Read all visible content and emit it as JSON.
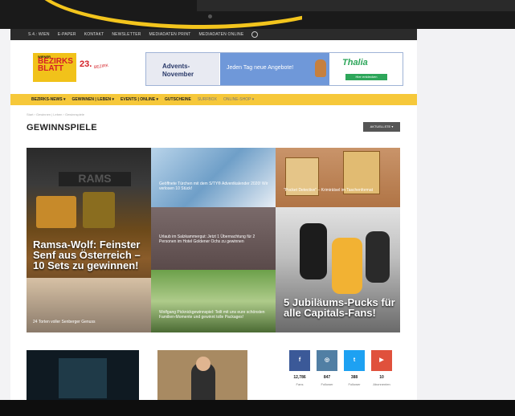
{
  "topnav": {
    "items": [
      "S.4.: WIEN",
      "E-PAPER",
      "KONTAKT",
      "NEWSLETTER",
      "MEDIADATEN PRINT",
      "MEDIADATEN ONLINE"
    ]
  },
  "logo": {
    "small": "WIENER",
    "name1": "BEZIRKS",
    "name2": "BLATT",
    "num": "23.",
    "tag": "BEZIRK"
  },
  "banner": {
    "advent1": "Advents-",
    "advent2": "November",
    "offer": "Jeden Tag neue Angebote!",
    "brand": "Thalia",
    "cta": "Hier entdecken"
  },
  "menu": {
    "items": [
      "BEZIRKS-NEWS ▾",
      "GEWINNEN | LEBEN ▾",
      "EVENTS | ONLINE ▾",
      "GUTSCHEINE",
      "SURFBOX",
      "ONLINE-SHOP ▾"
    ]
  },
  "breadcrumb": "Start › Gewinnen | Leben › Gewinnspiele",
  "page_title": "GEWINNSPIELE",
  "sort_label": "AKTUELLSTE ▾",
  "tiles": {
    "main_title": "Ramsa-Wolf: Feinster Senf aus Österreich – 10 Sets zu gewinnen!",
    "blue_caption": "Geöffnete Türchen mit dem S/TY® Adventkalender 2020! Wir verlosen 10 Stück!",
    "pocket_caption": "\"Pocket Detective\" – Krimirätsel im Taschenformat",
    "dark_caption": "Urlaub im Salzkammergut: Jetzt 1 Übernachtung für 2 Personen im Hotel Goldener Ochs zu gewinnen",
    "hockey_title": "5 Jubiläums-Pucks für alle Capitals-Fans!",
    "food_caption": "24 Torten voller Senberger Genuss",
    "picnic_caption": "Wolfgang Picknickgewinnspiel: Teilt mit uns eure schönsten Familien-Momente und gewinnt tolle Packages!"
  },
  "social": [
    {
      "icon": "f",
      "count": "12,786",
      "label": "Fans",
      "color": "#3b5998"
    },
    {
      "icon": "◎",
      "count": "847",
      "label": "Follower",
      "color": "#517fa4"
    },
    {
      "icon": "t",
      "count": "388",
      "label": "Follower",
      "color": "#1da1f2"
    },
    {
      "icon": "▶",
      "count": "10",
      "label": "Abonnenten",
      "color": "#e0513c"
    }
  ]
}
